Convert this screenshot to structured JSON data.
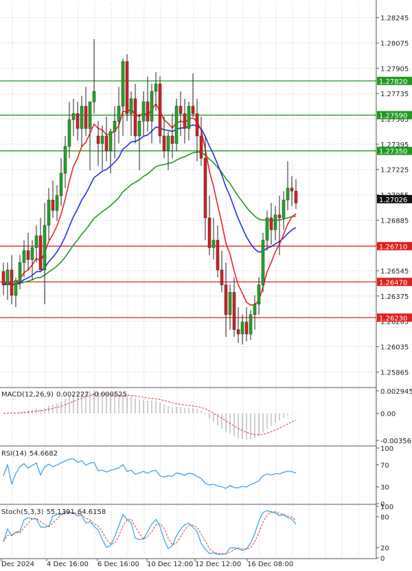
{
  "colors": {
    "grid": "#d9d9d9",
    "bull": "#22a722",
    "bear": "#d42020",
    "wick": "#222222",
    "ma_blue": "#1f2fe6",
    "ma_red": "#ee2222",
    "ma_green": "#1f9a1f",
    "level_green": "#1f9a1f",
    "level_red": "#e02020",
    "panel_border": "#555555",
    "macd_hist": "#a0a0a0",
    "macd_signal": "#e03030",
    "rsi": "#3399ee",
    "stoch_main": "#22aadd",
    "stoch_signal": "#e03030"
  },
  "chart_data": [
    {
      "type": "candlestick",
      "name": "price",
      "ylim": [
        1.25765,
        1.28345
      ],
      "y_ticks": [
        "1.28245",
        "1.28075",
        "1.27905",
        "1.27735",
        "1.27565",
        "1.27395",
        "1.27225",
        "1.27055",
        "1.26885",
        "1.26715",
        "1.26545",
        "1.26375",
        "1.26205",
        "1.26035",
        "1.25865"
      ],
      "x_ticks": [
        "Dec 2024",
        "4 Dec 16:00",
        "6 Dec 16:00",
        "10 Dec 12:00",
        "12 Dec 12:00",
        "16 Dec 08:00"
      ],
      "current_price": "1.27026",
      "levels": [
        {
          "value": 1.2782,
          "label": "1.27820",
          "color": "green"
        },
        {
          "value": 1.2759,
          "label": "1.27590",
          "color": "green"
        },
        {
          "value": 1.2735,
          "label": "1.27350",
          "color": "green"
        },
        {
          "value": 1.2671,
          "label": "1.26710",
          "color": "red"
        },
        {
          "value": 1.2647,
          "label": "1.26470",
          "color": "red"
        },
        {
          "value": 1.2623,
          "label": "1.26230",
          "color": "red"
        }
      ],
      "candles": [
        [
          1.2654,
          1.266,
          1.2638,
          1.2645
        ],
        [
          1.2645,
          1.266,
          1.2635,
          1.2655
        ],
        [
          1.2655,
          1.2665,
          1.2632,
          1.2638
        ],
        [
          1.2638,
          1.265,
          1.263,
          1.2648
        ],
        [
          1.2648,
          1.2665,
          1.2642,
          1.266
        ],
        [
          1.266,
          1.2675,
          1.265,
          1.2668
        ],
        [
          1.2668,
          1.268,
          1.2655,
          1.2662
        ],
        [
          1.2662,
          1.2675,
          1.2648,
          1.267
        ],
        [
          1.267,
          1.2685,
          1.266,
          1.2678
        ],
        [
          1.2678,
          1.269,
          1.2668,
          1.2655
        ],
        [
          1.2655,
          1.27,
          1.2632,
          1.2685
        ],
        [
          1.2685,
          1.271,
          1.2675,
          1.2702
        ],
        [
          1.2702,
          1.2715,
          1.269,
          1.2695
        ],
        [
          1.2695,
          1.2712,
          1.2688,
          1.2705
        ],
        [
          1.2705,
          1.273,
          1.2698,
          1.272
        ],
        [
          1.272,
          1.2745,
          1.271,
          1.2738
        ],
        [
          1.2738,
          1.2768,
          1.273,
          1.2756
        ],
        [
          1.2756,
          1.277,
          1.2745,
          1.276
        ],
        [
          1.276,
          1.2768,
          1.2742,
          1.275
        ],
        [
          1.275,
          1.2772,
          1.2738,
          1.2765
        ],
        [
          1.2765,
          1.2778,
          1.2745,
          1.275
        ],
        [
          1.275,
          1.2765,
          1.2722,
          1.2768
        ],
        [
          1.2768,
          1.281,
          1.276,
          1.2775
        ],
        [
          1.2745,
          1.2755,
          1.2725,
          1.274
        ],
        [
          1.274,
          1.2752,
          1.2722,
          1.2745
        ],
        [
          1.2745,
          1.2758,
          1.2728,
          1.2735
        ],
        [
          1.2735,
          1.275,
          1.272,
          1.2748
        ],
        [
          1.2748,
          1.2765,
          1.273,
          1.2755
        ],
        [
          1.2755,
          1.2778,
          1.274,
          1.2765
        ],
        [
          1.2765,
          1.2797,
          1.2745,
          1.2795
        ],
        [
          1.2795,
          1.28,
          1.2755,
          1.276
        ],
        [
          1.276,
          1.2775,
          1.2745,
          1.277
        ],
        [
          1.277,
          1.278,
          1.274,
          1.2745
        ],
        [
          1.2745,
          1.276,
          1.2722,
          1.2755
        ],
        [
          1.2755,
          1.2775,
          1.2745,
          1.2768
        ],
        [
          1.2768,
          1.2785,
          1.2748,
          1.2755
        ],
        [
          1.2755,
          1.278,
          1.274,
          1.2775
        ],
        [
          1.2775,
          1.2788,
          1.2762,
          1.278
        ],
        [
          1.278,
          1.2785,
          1.274,
          1.2745
        ],
        [
          1.2745,
          1.2758,
          1.273,
          1.2735
        ],
        [
          1.2735,
          1.2748,
          1.2722,
          1.2745
        ],
        [
          1.2745,
          1.276,
          1.273,
          1.274
        ],
        [
          1.274,
          1.277,
          1.2735,
          1.2765
        ],
        [
          1.2765,
          1.2775,
          1.2745,
          1.276
        ],
        [
          1.276,
          1.277,
          1.274,
          1.275
        ],
        [
          1.275,
          1.2768,
          1.2742,
          1.2765
        ],
        [
          1.2765,
          1.2787,
          1.2758,
          1.276
        ],
        [
          1.276,
          1.277,
          1.2728,
          1.2745
        ],
        [
          1.2745,
          1.2758,
          1.2725,
          1.273
        ],
        [
          1.273,
          1.2745,
          1.2675,
          1.269
        ],
        [
          1.269,
          1.2705,
          1.2665,
          1.267
        ],
        [
          1.267,
          1.269,
          1.2662,
          1.2675
        ],
        [
          1.2675,
          1.2685,
          1.265,
          1.2655
        ],
        [
          1.2655,
          1.2668,
          1.264,
          1.2645
        ],
        [
          1.2645,
          1.266,
          1.261,
          1.2625
        ],
        [
          1.2625,
          1.2645,
          1.2615,
          1.264
        ],
        [
          1.264,
          1.265,
          1.261,
          1.2615
        ],
        [
          1.2615,
          1.263,
          1.2606,
          1.2612
        ],
        [
          1.2612,
          1.2625,
          1.2605,
          1.262
        ],
        [
          1.262,
          1.263,
          1.2607,
          1.2612
        ],
        [
          1.2612,
          1.2628,
          1.2608,
          1.2625
        ],
        [
          1.2625,
          1.2638,
          1.2615,
          1.2632
        ],
        [
          1.2632,
          1.265,
          1.2625,
          1.2645
        ],
        [
          1.2645,
          1.268,
          1.264,
          1.2675
        ],
        [
          1.2675,
          1.2695,
          1.2668,
          1.269
        ],
        [
          1.269,
          1.27,
          1.2672,
          1.2682
        ],
        [
          1.2682,
          1.2698,
          1.2675,
          1.2692
        ],
        [
          1.2692,
          1.2705,
          1.2665,
          1.269
        ],
        [
          1.269,
          1.2708,
          1.2682,
          1.2702
        ],
        [
          1.2702,
          1.2728,
          1.2695,
          1.271
        ],
        [
          1.271,
          1.2718,
          1.2698,
          1.2708
        ],
        [
          1.2708,
          1.2716,
          1.2696,
          1.27
        ]
      ]
    },
    {
      "type": "line",
      "name": "MACD(12,26,9)",
      "header_values": [
        "0.002227",
        "-0.000525"
      ],
      "ylim": [
        -0.0042,
        0.0032
      ],
      "y_ticks": [
        {
          "value": 0.002945,
          "label": "0.002945"
        },
        {
          "value": 0.0,
          "label": "0.00"
        },
        {
          "value": -0.003566,
          "label": "-0.003566"
        }
      ]
    },
    {
      "type": "line",
      "name": "RSI(14)",
      "header_value": "54.6682",
      "ylim": [
        0,
        100
      ],
      "y_ticks": [
        {
          "value": 100,
          "label": "100"
        },
        {
          "value": 70,
          "label": "70"
        },
        {
          "value": 30,
          "label": "30"
        },
        {
          "value": 0,
          "label": "0"
        }
      ]
    },
    {
      "type": "line",
      "name": "Stoch(5,3,3)",
      "header_values": [
        "55.1391",
        "64.6158"
      ],
      "ylim": [
        0,
        100
      ],
      "y_ticks": [
        {
          "value": 100,
          "label": "100"
        },
        {
          "value": 80,
          "label": "80"
        },
        {
          "value": 20,
          "label": "20"
        },
        {
          "value": 0,
          "label": "0"
        }
      ]
    }
  ]
}
